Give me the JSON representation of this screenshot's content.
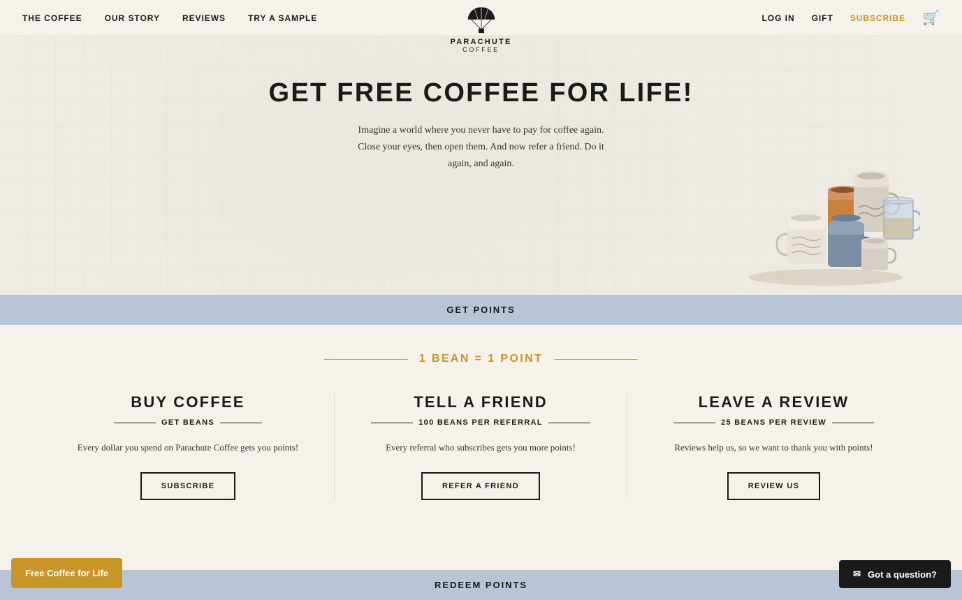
{
  "nav": {
    "links": [
      {
        "label": "THE COFFEE",
        "href": "#"
      },
      {
        "label": "OUR STORY",
        "href": "#"
      },
      {
        "label": "REVIEWS",
        "href": "#"
      },
      {
        "label": "TRY A SAMPLE",
        "href": "#"
      }
    ],
    "right_links": [
      {
        "label": "LOG IN",
        "href": "#",
        "class": "normal"
      },
      {
        "label": "GIFT",
        "href": "#",
        "class": "normal"
      },
      {
        "label": "SUBSCRIBE",
        "href": "#",
        "class": "subscribe"
      }
    ],
    "brand": "PARACHUTE",
    "brand_sub": "COFFEE"
  },
  "hero": {
    "title": "GET FREE COFFEE FOR LIFE!",
    "description": "Imagine a world where you never have to pay for coffee again. Close your eyes, then open them. And now refer a friend. Do it again, and again."
  },
  "get_points_banner": "GET POINTS",
  "bean_equation": "1 BEAN = 1 POINT",
  "cards": [
    {
      "title": "BUY COFFEE",
      "subtitle": "GET BEANS",
      "description": "Every dollar you spend on Parachute Coffee gets you points!",
      "button_label": "SUBSCRIBE"
    },
    {
      "title": "TELL A FRIEND",
      "subtitle": "100 BEANS PER REFERRAL",
      "description": "Every referral who subscribes gets you more points!",
      "button_label": "REFER A FRIEND"
    },
    {
      "title": "LEAVE A REVIEW",
      "subtitle": "25 BEANS PER REVIEW",
      "description": "Reviews help us, so we want to thank you with points!",
      "button_label": "REVIEW US"
    }
  ],
  "redeem_banner": "REDEEM POINTS",
  "toast": "Free Coffee for Life",
  "question_button": "Got a question?"
}
